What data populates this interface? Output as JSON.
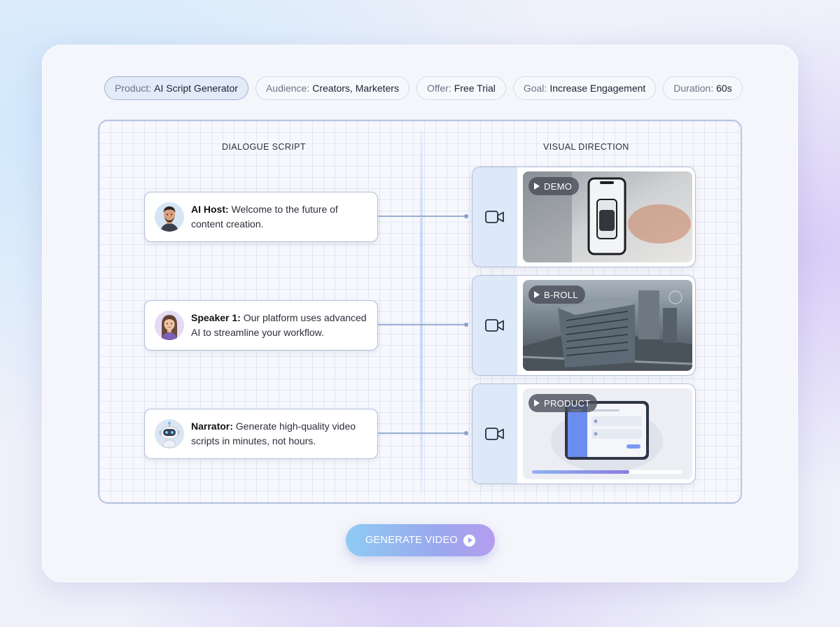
{
  "chips": [
    {
      "key": "Product:",
      "value": "AI Script Generator"
    },
    {
      "key": "Audience:",
      "value": "Creators, Marketers"
    },
    {
      "key": "Offer:",
      "value": "Free Trial"
    },
    {
      "key": "Goal:",
      "value": "Increase Engagement"
    },
    {
      "key": "Duration:",
      "value": "60s"
    }
  ],
  "columns": {
    "left_title": "DIALOGUE SCRIPT",
    "right_title": "VISUAL DIRECTION"
  },
  "dialogue": [
    {
      "speaker": "AI Host:",
      "line": "Welcome to the future of content creation."
    },
    {
      "speaker": "Speaker 1:",
      "line": "Our platform uses advanced AI to streamline your workflow."
    },
    {
      "speaker": "Narrator:",
      "line": "Generate high-quality video scripts in minutes, not hours."
    }
  ],
  "visuals": [
    {
      "tag": "DEMO",
      "icon": "video-camera-icon"
    },
    {
      "tag": "B-ROLL",
      "icon": "video-camera-icon"
    },
    {
      "tag": "PRODUCT",
      "icon": "video-camera-icon",
      "progress": 0.65
    }
  ],
  "generate_button": {
    "label": "GENERATE VIDEO",
    "icon": "play-circle-icon"
  },
  "colors": {
    "accent_start": "#8ecbf3",
    "accent_end": "#b49cef",
    "panel_border": "#b7c4e2"
  }
}
